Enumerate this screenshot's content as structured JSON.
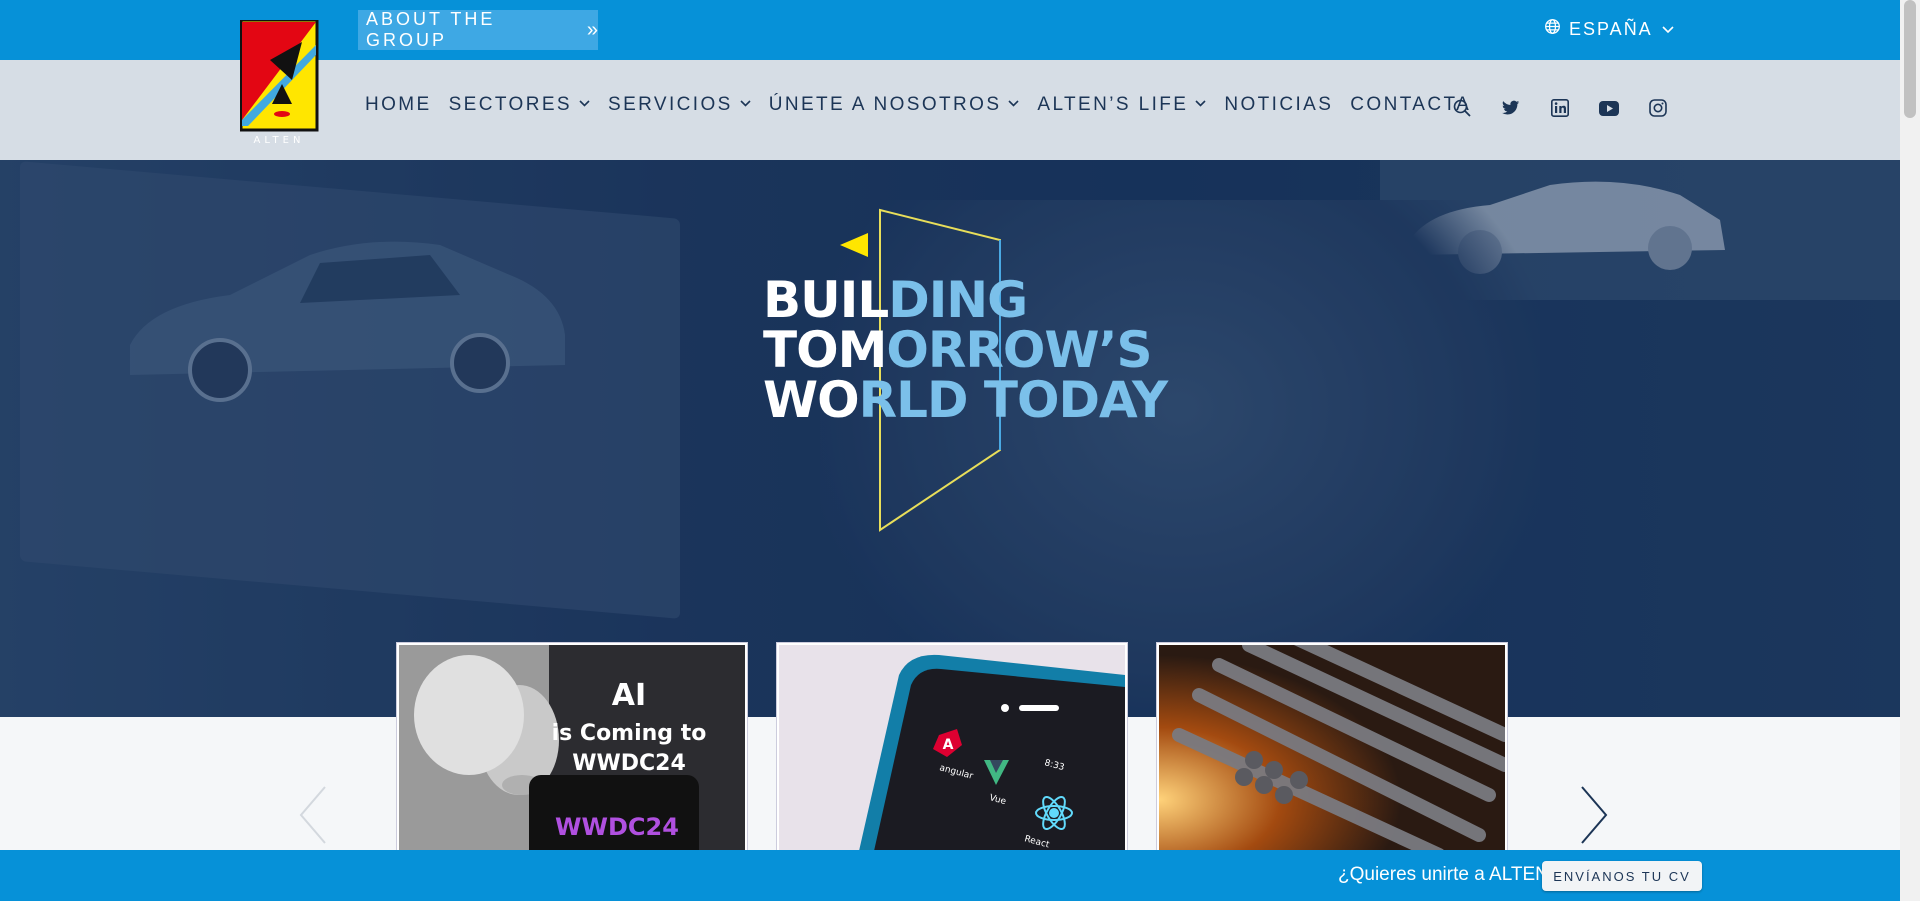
{
  "top_bar": {
    "about_label": "ABOUT THE GROUP",
    "about_chevron": "»",
    "language_label": "ESPAÑA",
    "language_icon": "globe-icon",
    "bg_color": "#0691d8"
  },
  "logo": {
    "text": "ALTEN"
  },
  "nav": {
    "items": [
      {
        "label": "HOME",
        "dropdown": false
      },
      {
        "label": "SECTORES",
        "dropdown": true
      },
      {
        "label": "SERVICIOS",
        "dropdown": true
      },
      {
        "label": "ÚNETE A NOSOTROS",
        "dropdown": true
      },
      {
        "label": "ALTEN’S LIFE",
        "dropdown": true
      },
      {
        "label": "NOTICIAS",
        "dropdown": false
      },
      {
        "label": "CONTACTA",
        "dropdown": false
      }
    ],
    "social_icons": [
      "search-icon",
      "twitter-icon",
      "linkedin-icon",
      "youtube-icon",
      "instagram-icon"
    ]
  },
  "hero": {
    "title_lines": [
      {
        "white": "BUIL",
        "blue": "DING"
      },
      {
        "white": "TOM",
        "blue": "ORROW’S"
      },
      {
        "white": "WO",
        "blue": "RLD TODAY"
      }
    ]
  },
  "cards": [
    {
      "name": "ai-wwdc24-card",
      "image_text_1": "AI",
      "image_text_2": "is Coming to",
      "image_text_3": "WWDC24",
      "image_text_4": "WWDC24"
    },
    {
      "name": "frameworks-phone-card",
      "apps": [
        "angular",
        "Vue",
        "React"
      ],
      "time": "8:33"
    },
    {
      "name": "steel-rebar-card"
    }
  ],
  "bottom_bar": {
    "question": "¿Quieres unirte a ALTEN?",
    "button_label": "ENVÍANOS TU CV"
  },
  "colors": {
    "brand_blue": "#0691d8",
    "nav_text": "#1c3556",
    "hero_blue_text": "#7bc0ea",
    "logo_yellow": "#ffe600",
    "logo_red": "#e30613"
  }
}
